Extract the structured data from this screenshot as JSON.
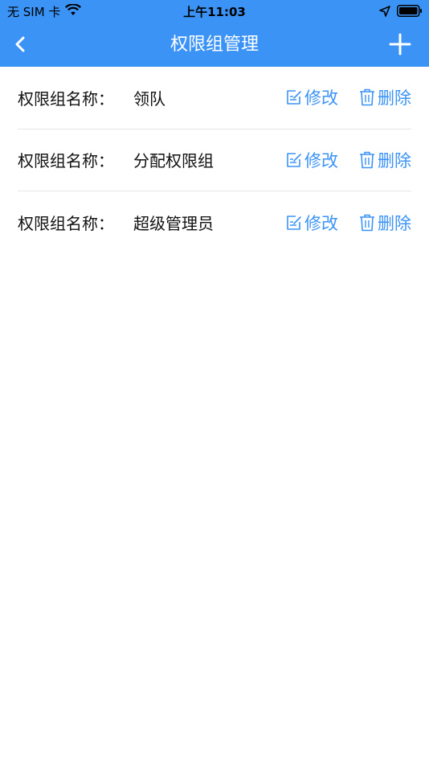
{
  "status_bar": {
    "carrier": "无 SIM 卡",
    "time": "上午11:03",
    "icons": [
      "wifi-icon",
      "location-arrow-icon",
      "battery-icon"
    ]
  },
  "nav": {
    "title": "权限组管理",
    "back_icon": "chevron-left-icon",
    "add_icon": "plus-icon"
  },
  "colors": {
    "accent": "#3b93f5",
    "text": "#111111",
    "divider": "#e6e6e6"
  },
  "groups": [
    {
      "label": "权限组名称：",
      "name": "领队",
      "edit_label": "修改",
      "delete_label": "删除"
    },
    {
      "label": "权限组名称：",
      "name": "分配权限组",
      "edit_label": "修改",
      "delete_label": "删除"
    },
    {
      "label": "权限组名称：",
      "name": "超级管理员",
      "edit_label": "修改",
      "delete_label": "删除"
    }
  ]
}
